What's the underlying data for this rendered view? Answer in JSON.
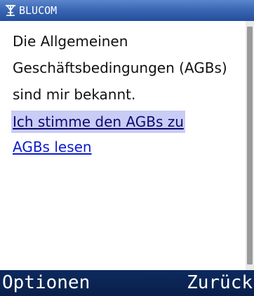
{
  "title_bar": {
    "title": "BLUCOM",
    "icon": "antenna-signal-icon",
    "color": "#3b67b5"
  },
  "content": {
    "text_lines": [
      "Die Allgemeinen",
      "Geschäftsbedingungen (AGBs)",
      "sind mir bekannt."
    ],
    "links": [
      {
        "label": "Ich stimme den AGBs zu",
        "selected": true
      },
      {
        "label": "AGBs lesen",
        "selected": false
      }
    ],
    "link_color": "#0a1ad0",
    "selection_color": "#c9ccf5"
  },
  "softkeys": {
    "left_label": "Optionen",
    "right_label": "Zurück",
    "color": "#0c2a5e"
  }
}
